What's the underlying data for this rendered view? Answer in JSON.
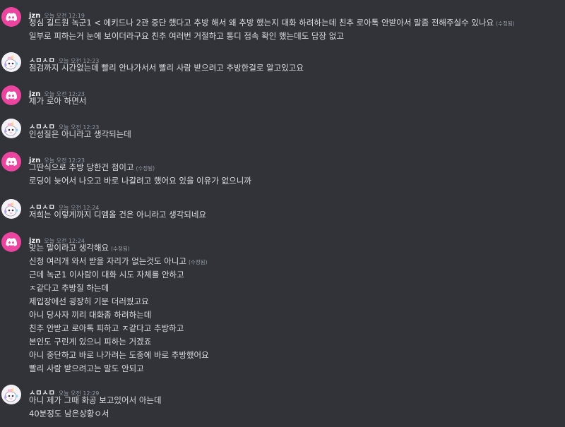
{
  "groups": [
    {
      "author": "jzn",
      "avatar": "discord-logo-icon",
      "time": "오늘 오전 12:19",
      "lines": [
        {
          "text": "청심  길드원 녹군1 < 에키드나 2관 중단 했다고 추방 해서 왜 추방 했는지 대화 하려하는데 친추 로아톡 안받아서 말좀 전해주실수 있나요",
          "edited": "(수정됨)"
        },
        {
          "text": "일부로 피하는거 눈에 보이더라구요 친추 여러번 거절하고 통디 접속 확인 했는데도 답장 없고",
          "edited": ""
        }
      ]
    },
    {
      "author": "ㅅㅁㅅㅁ",
      "avatar": "unicorn-avatar-icon",
      "time": "오늘 오전 12:23",
      "lines": [
        {
          "text": "점검까지 시간없는데 빨리 안나가서서 빨리 사람 받으려고 추방한걸로 알고있고요",
          "edited": ""
        }
      ]
    },
    {
      "author": "jzn",
      "avatar": "discord-logo-icon",
      "time": "오늘 오전 12:23",
      "lines": [
        {
          "text": "제가 로아 하면서",
          "edited": ""
        }
      ]
    },
    {
      "author": "ㅅㅁㅅㅁ",
      "avatar": "unicorn-avatar-icon",
      "time": "오늘 오전 12:23",
      "lines": [
        {
          "text": "인성질은 아니라고 생각되는데",
          "edited": ""
        }
      ]
    },
    {
      "author": "jzn",
      "avatar": "discord-logo-icon",
      "time": "오늘 오전 12:23",
      "lines": [
        {
          "text": "그딴식으로 추방 당한건 첨이고",
          "edited": "(수정됨)"
        },
        {
          "text": "로딩이 늦어서 나오고 바로 나갈려고 했어요 있을 이유가 없으니까",
          "edited": ""
        }
      ]
    },
    {
      "author": "ㅅㅁㅅㅁ",
      "avatar": "unicorn-avatar-icon",
      "time": "오늘 오전 12:24",
      "lines": [
        {
          "text": "저희는 이렇게까지 디엠올 건은 아니라고 생각되네요",
          "edited": ""
        }
      ]
    },
    {
      "author": "jzn",
      "avatar": "discord-logo-icon",
      "time": "오늘 오전 12:24",
      "lines": [
        {
          "text": "맞는 말이라고 생각해요",
          "edited": "(수정됨)"
        },
        {
          "text": "신청 여러개 와서 받을 자리가 없는것도 아니고",
          "edited": "(수정됨)"
        },
        {
          "text": "근데 녹군1 이사람이  대화 시도 자체를 안하고",
          "edited": ""
        },
        {
          "text": "ㅈ같다고 추방질 하는데",
          "edited": ""
        },
        {
          "text": "제입장에선 굉장히 기분 더러웠고요",
          "edited": ""
        },
        {
          "text": "아니 당사자 끼리 대화좀 하려하는데",
          "edited": ""
        },
        {
          "text": "친추 안받고 로아톡 피하고  ㅈ같다고 추방하고",
          "edited": ""
        },
        {
          "text": "본인도 구린게 있으니 피하는 거겠죠",
          "edited": ""
        },
        {
          "text": "아니 중단하고 바로 나가려는 도중에 바로 추방했어요",
          "edited": ""
        },
        {
          "text": "빨리 사람 받으려고는 말도 안되고",
          "edited": ""
        }
      ]
    },
    {
      "author": "ㅅㅁㅅㅁ",
      "avatar": "unicorn-avatar-icon",
      "time": "오늘 오전 12:29",
      "lines": [
        {
          "text": "아니 제가 그때 화공 보고있어서 아는데",
          "edited": ""
        },
        {
          "text": "40분정도 남은상황ㅇ서",
          "edited": ""
        }
      ]
    }
  ]
}
